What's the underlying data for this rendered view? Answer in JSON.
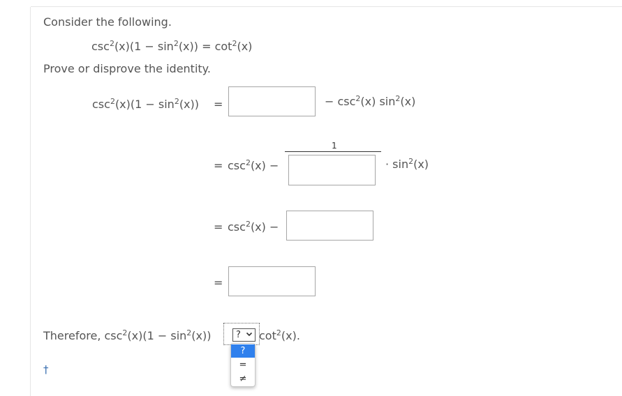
{
  "intro": "Consider the following.",
  "identity": {
    "lhs_a": "csc",
    "lhs_b": "(x)(1 − sin",
    "lhs_c": "(x)) = cot",
    "lhs_d": "(x)",
    "exp": "2"
  },
  "prompt": "Prove or disprove the identity.",
  "step1": {
    "lhs_a": "csc",
    "lhs_b": "(x)(1 − sin",
    "lhs_c": "(x))",
    "eq": "=",
    "rhs_a": "− csc",
    "rhs_b": "(x) sin",
    "rhs_c": "(x)"
  },
  "step2": {
    "eq": "=",
    "csc_a": "csc",
    "csc_b": "(x) −",
    "numerator": "1",
    "tail_a": "· sin",
    "tail_b": "(x)"
  },
  "step3": {
    "eq": "=",
    "csc_a": "csc",
    "csc_b": "(x) −"
  },
  "step4": {
    "eq": "="
  },
  "conclusion": {
    "prefix": "Therefore,  csc",
    "mid1": "(x)(1 − sin",
    "mid2": "(x))",
    "suffix_a": "cot",
    "suffix_b": "(x)."
  },
  "select": {
    "value": "?",
    "options": [
      "?",
      "=",
      "≠"
    ]
  },
  "footer_symbol": "†",
  "colors": {
    "accent": "#2f80ed",
    "text": "#555555",
    "border": "#a6a6a6"
  }
}
